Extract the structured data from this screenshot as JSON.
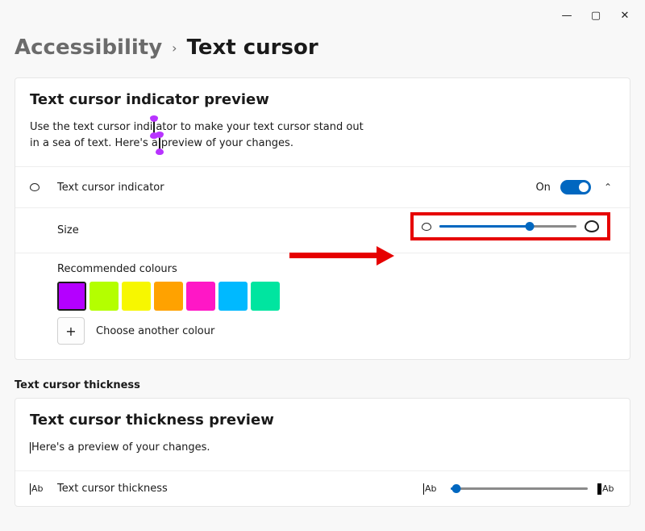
{
  "window": {
    "minimize": "—",
    "maximize": "▢",
    "close": "✕"
  },
  "breadcrumb": {
    "parent": "Accessibility",
    "chevron": "›",
    "current": "Text cursor"
  },
  "preview": {
    "title": "Text cursor indicator preview",
    "line1a": "Use the text cursor indi",
    "line1b": "ator to make your text cursor stand out",
    "line2a": "in a sea of text. Here's a",
    "line2b": "preview of your changes."
  },
  "indicator_row": {
    "label": "Text cursor indicator",
    "state_label": "On",
    "chevron": "⌃"
  },
  "size_row": {
    "label": "Size",
    "slider": {
      "value": 66,
      "min": 0,
      "max": 100
    }
  },
  "colors": {
    "title": "Recommended colours",
    "swatches": [
      {
        "hex": "#b400ff",
        "selected": true
      },
      {
        "hex": "#b4ff00",
        "selected": false
      },
      {
        "hex": "#f7f700",
        "selected": false
      },
      {
        "hex": "#ffa200",
        "selected": false
      },
      {
        "hex": "#ff17c6",
        "selected": false
      },
      {
        "hex": "#00b9ff",
        "selected": false
      },
      {
        "hex": "#00e5a0",
        "selected": false
      }
    ],
    "add_label": "Choose another colour",
    "plus": "+"
  },
  "thickness": {
    "subheader": "Text cursor thickness",
    "preview_title": "Text cursor thickness preview",
    "preview_text": "Here's a preview of your changes.",
    "row_label": "Text cursor thickness",
    "ab": "Ab",
    "slider": {
      "value": 4,
      "min": 0,
      "max": 100
    }
  }
}
